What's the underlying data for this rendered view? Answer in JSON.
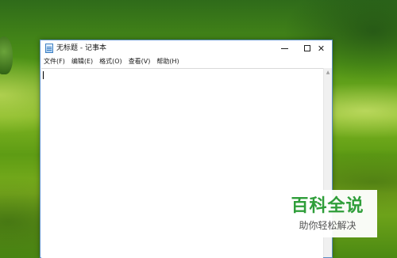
{
  "window": {
    "title": "无标题 - 记事本",
    "minimize_label": "",
    "maximize_label": "",
    "close_label": "✕"
  },
  "menu": {
    "items": [
      "文件(F)",
      "编辑(E)",
      "格式(O)",
      "查看(V)",
      "帮助(H)"
    ]
  },
  "editor": {
    "text": ""
  },
  "icons": {
    "app": "notepad-icon",
    "minimize": "minimize-icon",
    "maximize": "maximize-icon",
    "close": "close-icon",
    "scroll_up": "chevron-up-icon"
  },
  "watermark": {
    "title": "百科全说",
    "subtitle": "助你轻松解决"
  },
  "colors": {
    "accent": "#2f9e3a",
    "window_border": "#5a8fc4"
  }
}
